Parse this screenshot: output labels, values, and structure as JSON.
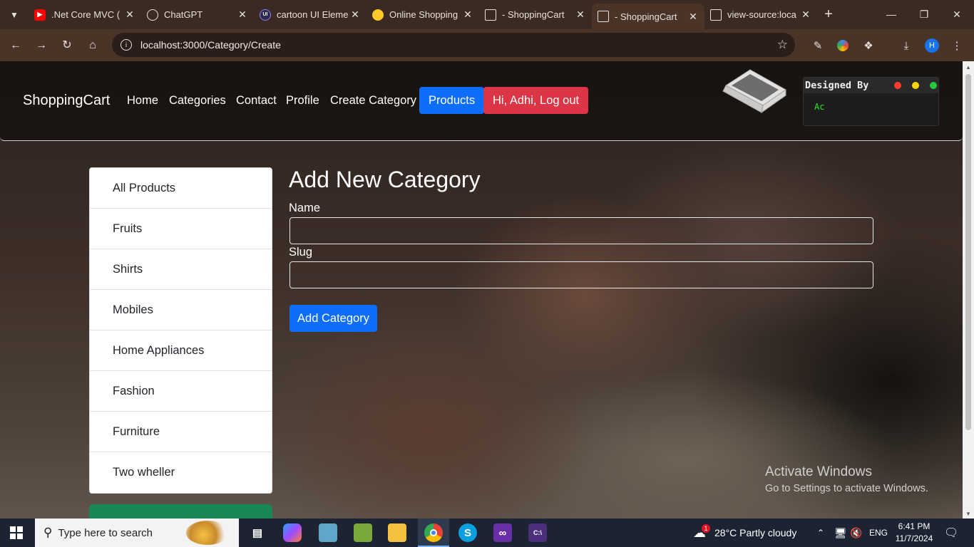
{
  "browser": {
    "tabs": [
      {
        "title": ".Net Core MVC (",
        "icon": "youtube-icon"
      },
      {
        "title": "ChatGPT",
        "icon": "chatgpt-icon"
      },
      {
        "title": "cartoon UI Eleme",
        "icon": "uiverse-icon"
      },
      {
        "title": "Online Shopping",
        "icon": "firebase-icon"
      },
      {
        "title": "- ShoppingCart",
        "icon": "page-icon"
      },
      {
        "title": "- ShoppingCart",
        "icon": "page-icon"
      },
      {
        "title": "view-source:loca",
        "icon": "page-icon"
      }
    ],
    "active_tab_index": 5,
    "url": "localhost:3000/Category/Create",
    "profile_initial": "H"
  },
  "site": {
    "brand": "ShoppingCart",
    "nav": {
      "home": "Home",
      "categories": "Categories",
      "contact": "Contact",
      "profile": "Profile",
      "create_category": "Create Category",
      "products": "Products",
      "logout": "Hi, Adhi, Log out"
    },
    "terminal": {
      "title": "Designed By",
      "text": "Ac"
    }
  },
  "sidebar": {
    "items": [
      "All Products",
      "Fruits",
      "Shirts",
      "Mobiles",
      "Home Appliances",
      "Fashion",
      "Furniture",
      "Two wheller"
    ]
  },
  "form": {
    "title": "Add New Category",
    "name_label": "Name",
    "name_value": "",
    "slug_label": "Slug",
    "slug_value": "",
    "submit_label": "Add Category"
  },
  "watermark": {
    "line1": "Activate Windows",
    "line2": "Go to Settings to activate Windows."
  },
  "taskbar": {
    "search_placeholder": "Type here to search",
    "weather": "28°C  Partly cloudy",
    "weather_badge": "1",
    "language": "ENG",
    "time": "6:41 PM",
    "date": "11/7/2024"
  },
  "colors": {
    "chrome_frame": "#3b2a22",
    "toolbar": "#4a3428",
    "primary": "#0d6efd",
    "danger": "#dc3545",
    "success": "#198754"
  }
}
